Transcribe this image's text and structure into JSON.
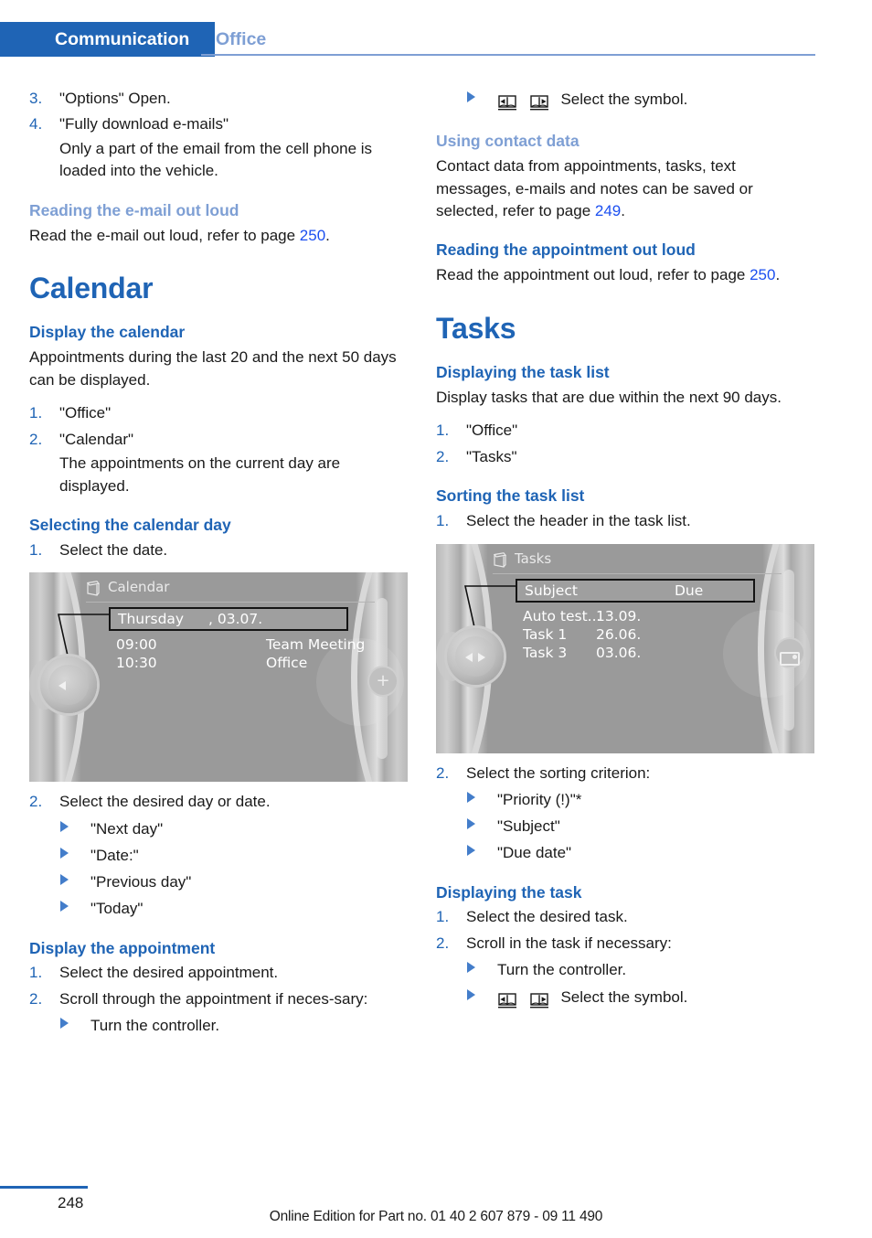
{
  "header": {
    "active_tab": "Communication",
    "inactive_tab": "Office",
    "accent_color": "#1f64b5",
    "muted_accent_color": "#7e9fd4"
  },
  "left_column": {
    "steps_top": [
      {
        "num": "3.",
        "text": "\"Options\" Open."
      },
      {
        "num": "4.",
        "text": "\"Fully download e-mails\"",
        "sub": "Only a part of the email from the cell phone is loaded into the vehicle."
      }
    ],
    "reading_email": {
      "heading": "Reading the e-mail out loud",
      "body_prefix": "Read the e-mail out loud, refer to page ",
      "page_ref": "250",
      "body_suffix": "."
    },
    "calendar_chapter": "Calendar",
    "display_calendar": {
      "heading": "Display the calendar",
      "intro": "Appointments during the last 20 and the next 50 days can be displayed.",
      "steps": [
        {
          "num": "1.",
          "text": "\"Office\""
        },
        {
          "num": "2.",
          "text": "\"Calendar\"",
          "sub": "The appointments on the current day are displayed."
        }
      ]
    },
    "selecting_day": {
      "heading": "Selecting the calendar day",
      "step1_num": "1.",
      "step1_text": "Select the date.",
      "step2_num": "2.",
      "step2_text": "Select the desired day or date.",
      "options": [
        "\"Next day\"",
        "\"Date:\"",
        "\"Previous day\"",
        "\"Today\""
      ]
    },
    "display_appointment": {
      "heading": "Display the appointment",
      "steps": [
        {
          "num": "1.",
          "text": "Select the desired appointment."
        },
        {
          "num": "2.",
          "text": "Scroll through the appointment if neces-­sary:"
        }
      ],
      "bullets": [
        "Turn the controller."
      ]
    },
    "calendar_screen": {
      "title": "Calendar",
      "title_icon": "book-icon",
      "header_row": {
        "day": "Thursday",
        "date": ", 03.07."
      },
      "rows": [
        {
          "time": "09:00",
          "subject": "Team Meeting"
        },
        {
          "time": "10:30",
          "subject": "Office"
        }
      ],
      "side_button": "plus-icon"
    }
  },
  "right_column": {
    "select_symbol_top": {
      "icon_left": "book-page-back-icon",
      "icon_right": "book-page-forward-icon",
      "text": "Select the symbol."
    },
    "using_contact_data": {
      "heading": "Using contact data",
      "body_prefix": "Contact data from appointments, tasks, text messages, e-mails and notes can be saved or selected, refer to page ",
      "page_ref": "249",
      "body_suffix": "."
    },
    "reading_appointment": {
      "heading": "Reading the appointment out loud",
      "body_prefix": "Read the appointment out loud, refer to page ",
      "page_ref": "250",
      "body_suffix": "."
    },
    "tasks_chapter": "Tasks",
    "displaying_task_list": {
      "heading": "Displaying the task list",
      "intro": "Display tasks that are due within the next 90 days.",
      "steps": [
        {
          "num": "1.",
          "text": "\"Office\""
        },
        {
          "num": "2.",
          "text": "\"Tasks\""
        }
      ]
    },
    "sorting_task_list": {
      "heading": "Sorting the task list",
      "step1_num": "1.",
      "step1_text": "Select the header in the task list.",
      "step2_num": "2.",
      "step2_text": "Select the sorting criterion:",
      "criteria": [
        "\"Priority (!)\"*",
        "\"Subject\"",
        "\"Due date\""
      ]
    },
    "displaying_task": {
      "heading": "Displaying the task",
      "steps": [
        {
          "num": "1.",
          "text": "Select the desired task."
        },
        {
          "num": "2.",
          "text": "Scroll in the task if necessary:"
        }
      ],
      "bullet_turn": "Turn the controller.",
      "bullet_symbol": "Select the symbol."
    },
    "tasks_screen": {
      "title": "Tasks",
      "title_icon": "book-icon",
      "header_row": {
        "subject": "Subject",
        "due": "Due"
      },
      "rows": [
        {
          "subject": "Auto test...",
          "due": "13.09."
        },
        {
          "subject": "Task 1",
          "due": "26.06."
        },
        {
          "subject": "Task 3",
          "due": "03.06."
        }
      ],
      "side_button": "media-icon"
    }
  },
  "footer": {
    "page_number": "248",
    "note": "Online Edition for Part no. 01 40 2 607 879 - 09 11 490"
  }
}
